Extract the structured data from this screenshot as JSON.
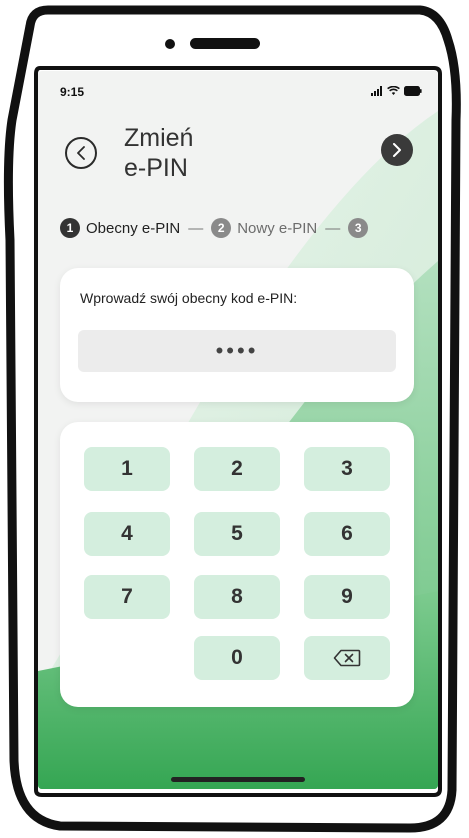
{
  "status_bar": {
    "time": "9:15",
    "icons": [
      "signal-icon",
      "wifi-icon",
      "battery-icon"
    ]
  },
  "header": {
    "title_line1": "Zmień",
    "title_line2": "e-PIN",
    "back_icon": "chevron-left-icon",
    "next_icon": "chevron-right-icon"
  },
  "stepper": {
    "steps": [
      {
        "number": "1",
        "label": "Obecny e-PIN",
        "active": true
      },
      {
        "number": "2",
        "label": "Nowy e-PIN",
        "active": false
      },
      {
        "number": "3",
        "label": "",
        "active": false
      }
    ],
    "separator": "—"
  },
  "pin_entry": {
    "prompt": "Wprowadź swój obecny kod e-PIN:",
    "masked_value": "••••"
  },
  "keypad": {
    "keys": [
      "1",
      "2",
      "3",
      "4",
      "5",
      "6",
      "7",
      "8",
      "9",
      "0"
    ],
    "backspace_icon": "backspace-icon"
  },
  "colors": {
    "accent_green": "#3fae5a",
    "key_background": "#d4eede",
    "dark": "#333333"
  }
}
